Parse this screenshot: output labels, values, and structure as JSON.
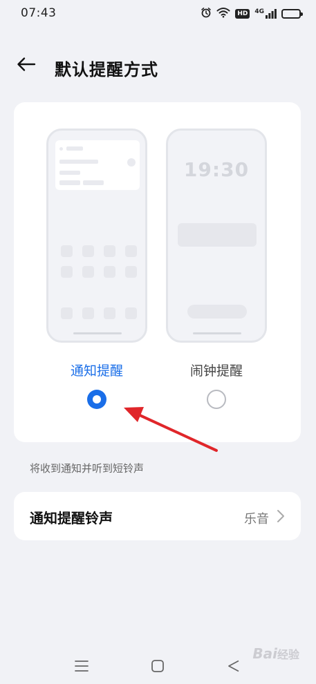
{
  "status_bar": {
    "time": "07:43",
    "hd_label": "HD",
    "network_label": "4G",
    "icons": [
      "alarm-icon",
      "wifi-icon",
      "hd-icon",
      "signal-icon",
      "battery-icon"
    ]
  },
  "header": {
    "title": "默认提醒方式",
    "back_icon": "arrow-left-icon"
  },
  "mode_card": {
    "options": [
      {
        "label": "通知提醒",
        "selected": true
      },
      {
        "label": "闹钟提醒",
        "selected": false
      }
    ],
    "lock_preview_time": "19:30"
  },
  "helper_text": "将收到通知并听到短铃声",
  "ringtone_row": {
    "title": "通知提醒铃声",
    "value": "乐音"
  },
  "nav_bar": {
    "icons": [
      "menu-icon",
      "home-square-icon",
      "back-triangle-icon"
    ]
  },
  "watermark": {
    "text": "Bai",
    "sub": "经验"
  },
  "colors": {
    "accent": "#1a6ee8",
    "background": "#f1f2f6",
    "card": "#ffffff",
    "annotation_arrow": "#e0262a"
  }
}
